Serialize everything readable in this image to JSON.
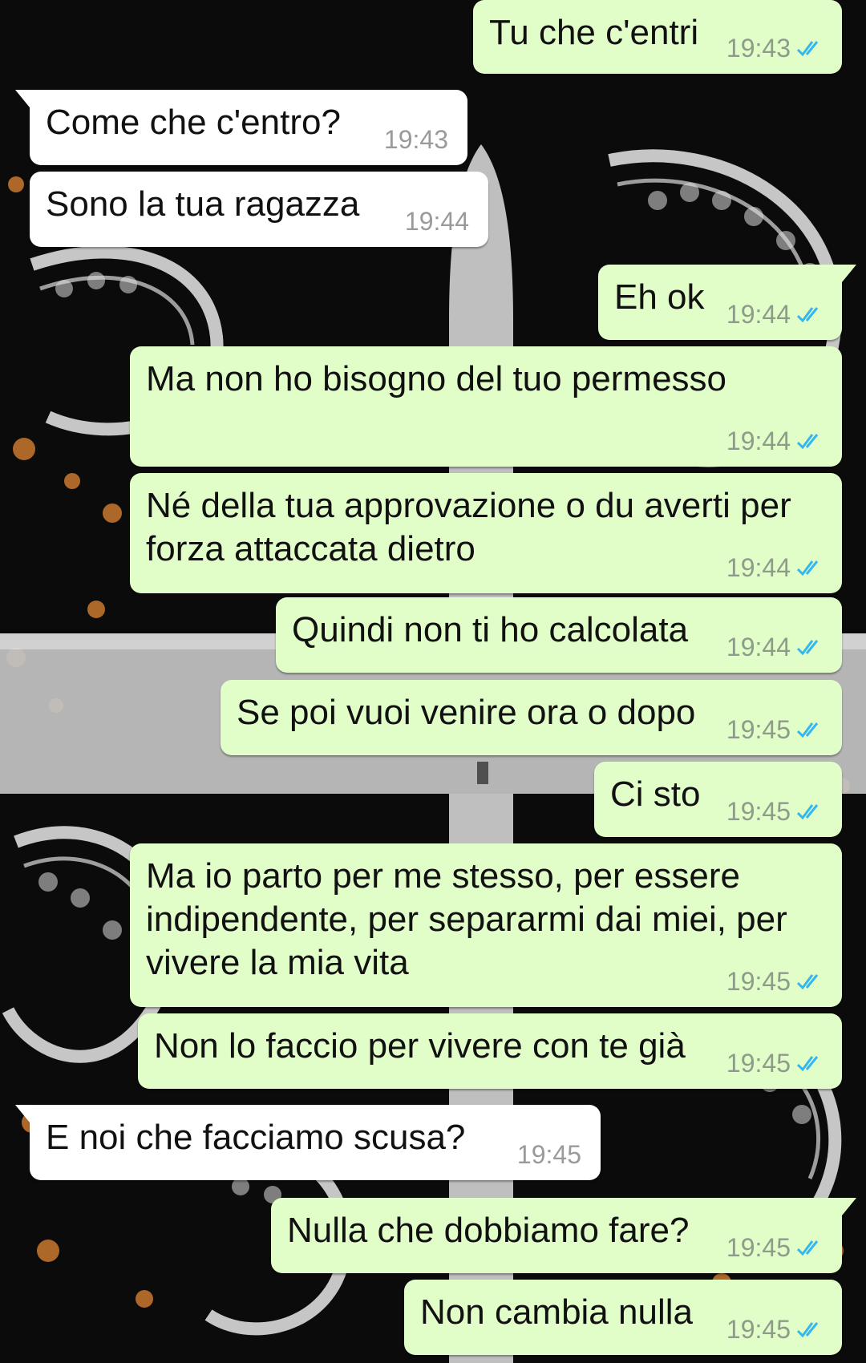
{
  "chat": {
    "read_tick_color": "#34b7f1",
    "outgoing_bubble_color": "#e1fdc8",
    "incoming_bubble_color": "#ffffff",
    "messages": [
      {
        "direction": "out",
        "text": "Tu che c'entri",
        "time": "19:43",
        "status": "read"
      },
      {
        "direction": "in",
        "text": "Come che c'entro?",
        "time": "19:43"
      },
      {
        "direction": "in",
        "text": "Sono la tua ragazza",
        "time": "19:44"
      },
      {
        "direction": "out",
        "text": "Eh ok",
        "time": "19:44",
        "status": "read"
      },
      {
        "direction": "out",
        "text": "Ma non ho bisogno del tuo permesso",
        "time": "19:44",
        "status": "read"
      },
      {
        "direction": "out",
        "text": "Né della tua approvazione o du averti per\nforza attaccata dietro",
        "time": "19:44",
        "status": "read"
      },
      {
        "direction": "out",
        "text": "Quindi non ti ho calcolata",
        "time": "19:44",
        "status": "read"
      },
      {
        "direction": "out",
        "text": "Se poi vuoi venire ora o dopo",
        "time": "19:45",
        "status": "read"
      },
      {
        "direction": "out",
        "text": "Ci sto",
        "time": "19:45",
        "status": "read"
      },
      {
        "direction": "out",
        "text": "Ma io parto per me stesso, per essere\nindipendente, per separarmi dai miei, per\nvivere la mia vita",
        "time": "19:45",
        "status": "read"
      },
      {
        "direction": "out",
        "text": "Non lo faccio per vivere con te già",
        "time": "19:45",
        "status": "read"
      },
      {
        "direction": "in",
        "text": "E noi che facciamo scusa?",
        "time": "19:45"
      },
      {
        "direction": "out",
        "text": "Nulla che dobbiamo fare?",
        "time": "19:45",
        "status": "read"
      },
      {
        "direction": "out",
        "text": "Non cambia nulla",
        "time": "19:45",
        "status": "read"
      }
    ]
  }
}
